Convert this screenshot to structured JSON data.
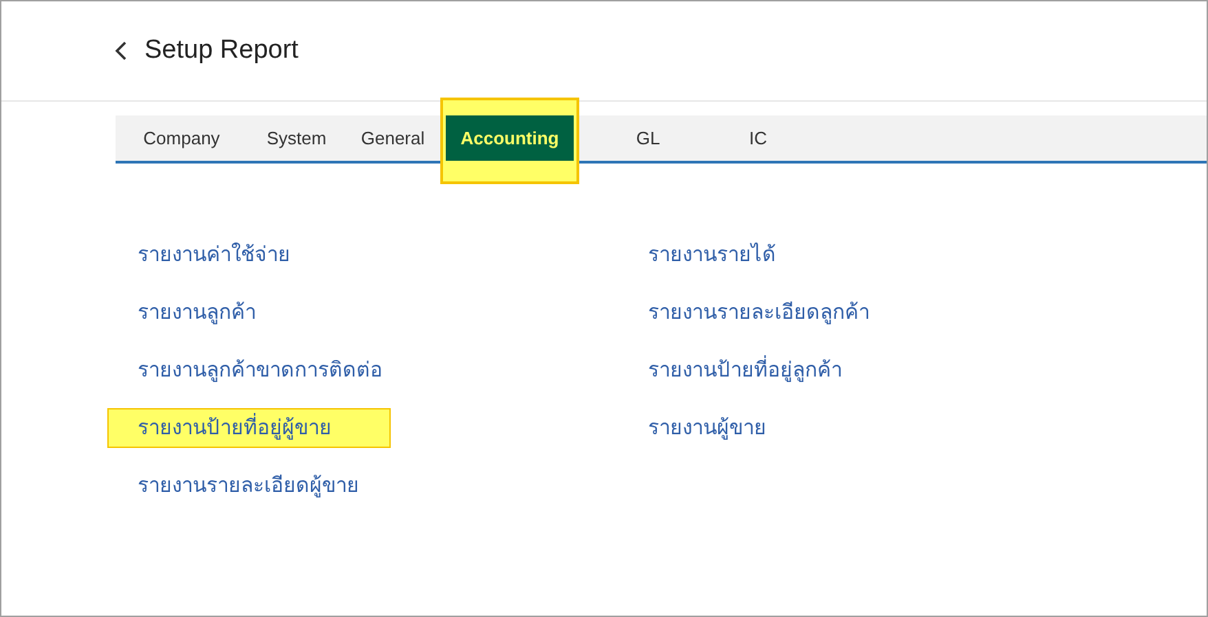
{
  "page": {
    "title": "Setup Report"
  },
  "tabs": [
    {
      "label": "Company",
      "selected": false,
      "highlighted": false
    },
    {
      "label": "System",
      "selected": false,
      "highlighted": false
    },
    {
      "label": "General",
      "selected": false,
      "highlighted": false
    },
    {
      "label": "Accounting",
      "selected": true,
      "highlighted": true
    },
    {
      "label": "GL",
      "selected": false,
      "highlighted": false
    },
    {
      "label": "IC",
      "selected": false,
      "highlighted": false
    }
  ],
  "report_columns": [
    [
      {
        "label": "รายงานค่าใช้จ่าย",
        "highlighted": false
      },
      {
        "label": "รายงานลูกค้า",
        "highlighted": false
      },
      {
        "label": "รายงานลูกค้าขาดการติดต่อ",
        "highlighted": false
      },
      {
        "label": "รายงานป้ายที่อยู่ผู้ขาย",
        "highlighted": true
      },
      {
        "label": "รายงานรายละเอียดผู้ขาย",
        "highlighted": false
      }
    ],
    [
      {
        "label": "รายงานรายได้",
        "highlighted": false
      },
      {
        "label": "รายงานรายละเอียดลูกค้า",
        "highlighted": false
      },
      {
        "label": "รายงานป้ายที่อยู่ลูกค้า",
        "highlighted": false
      },
      {
        "label": "รายงานผู้ขาย",
        "highlighted": false
      }
    ]
  ]
}
